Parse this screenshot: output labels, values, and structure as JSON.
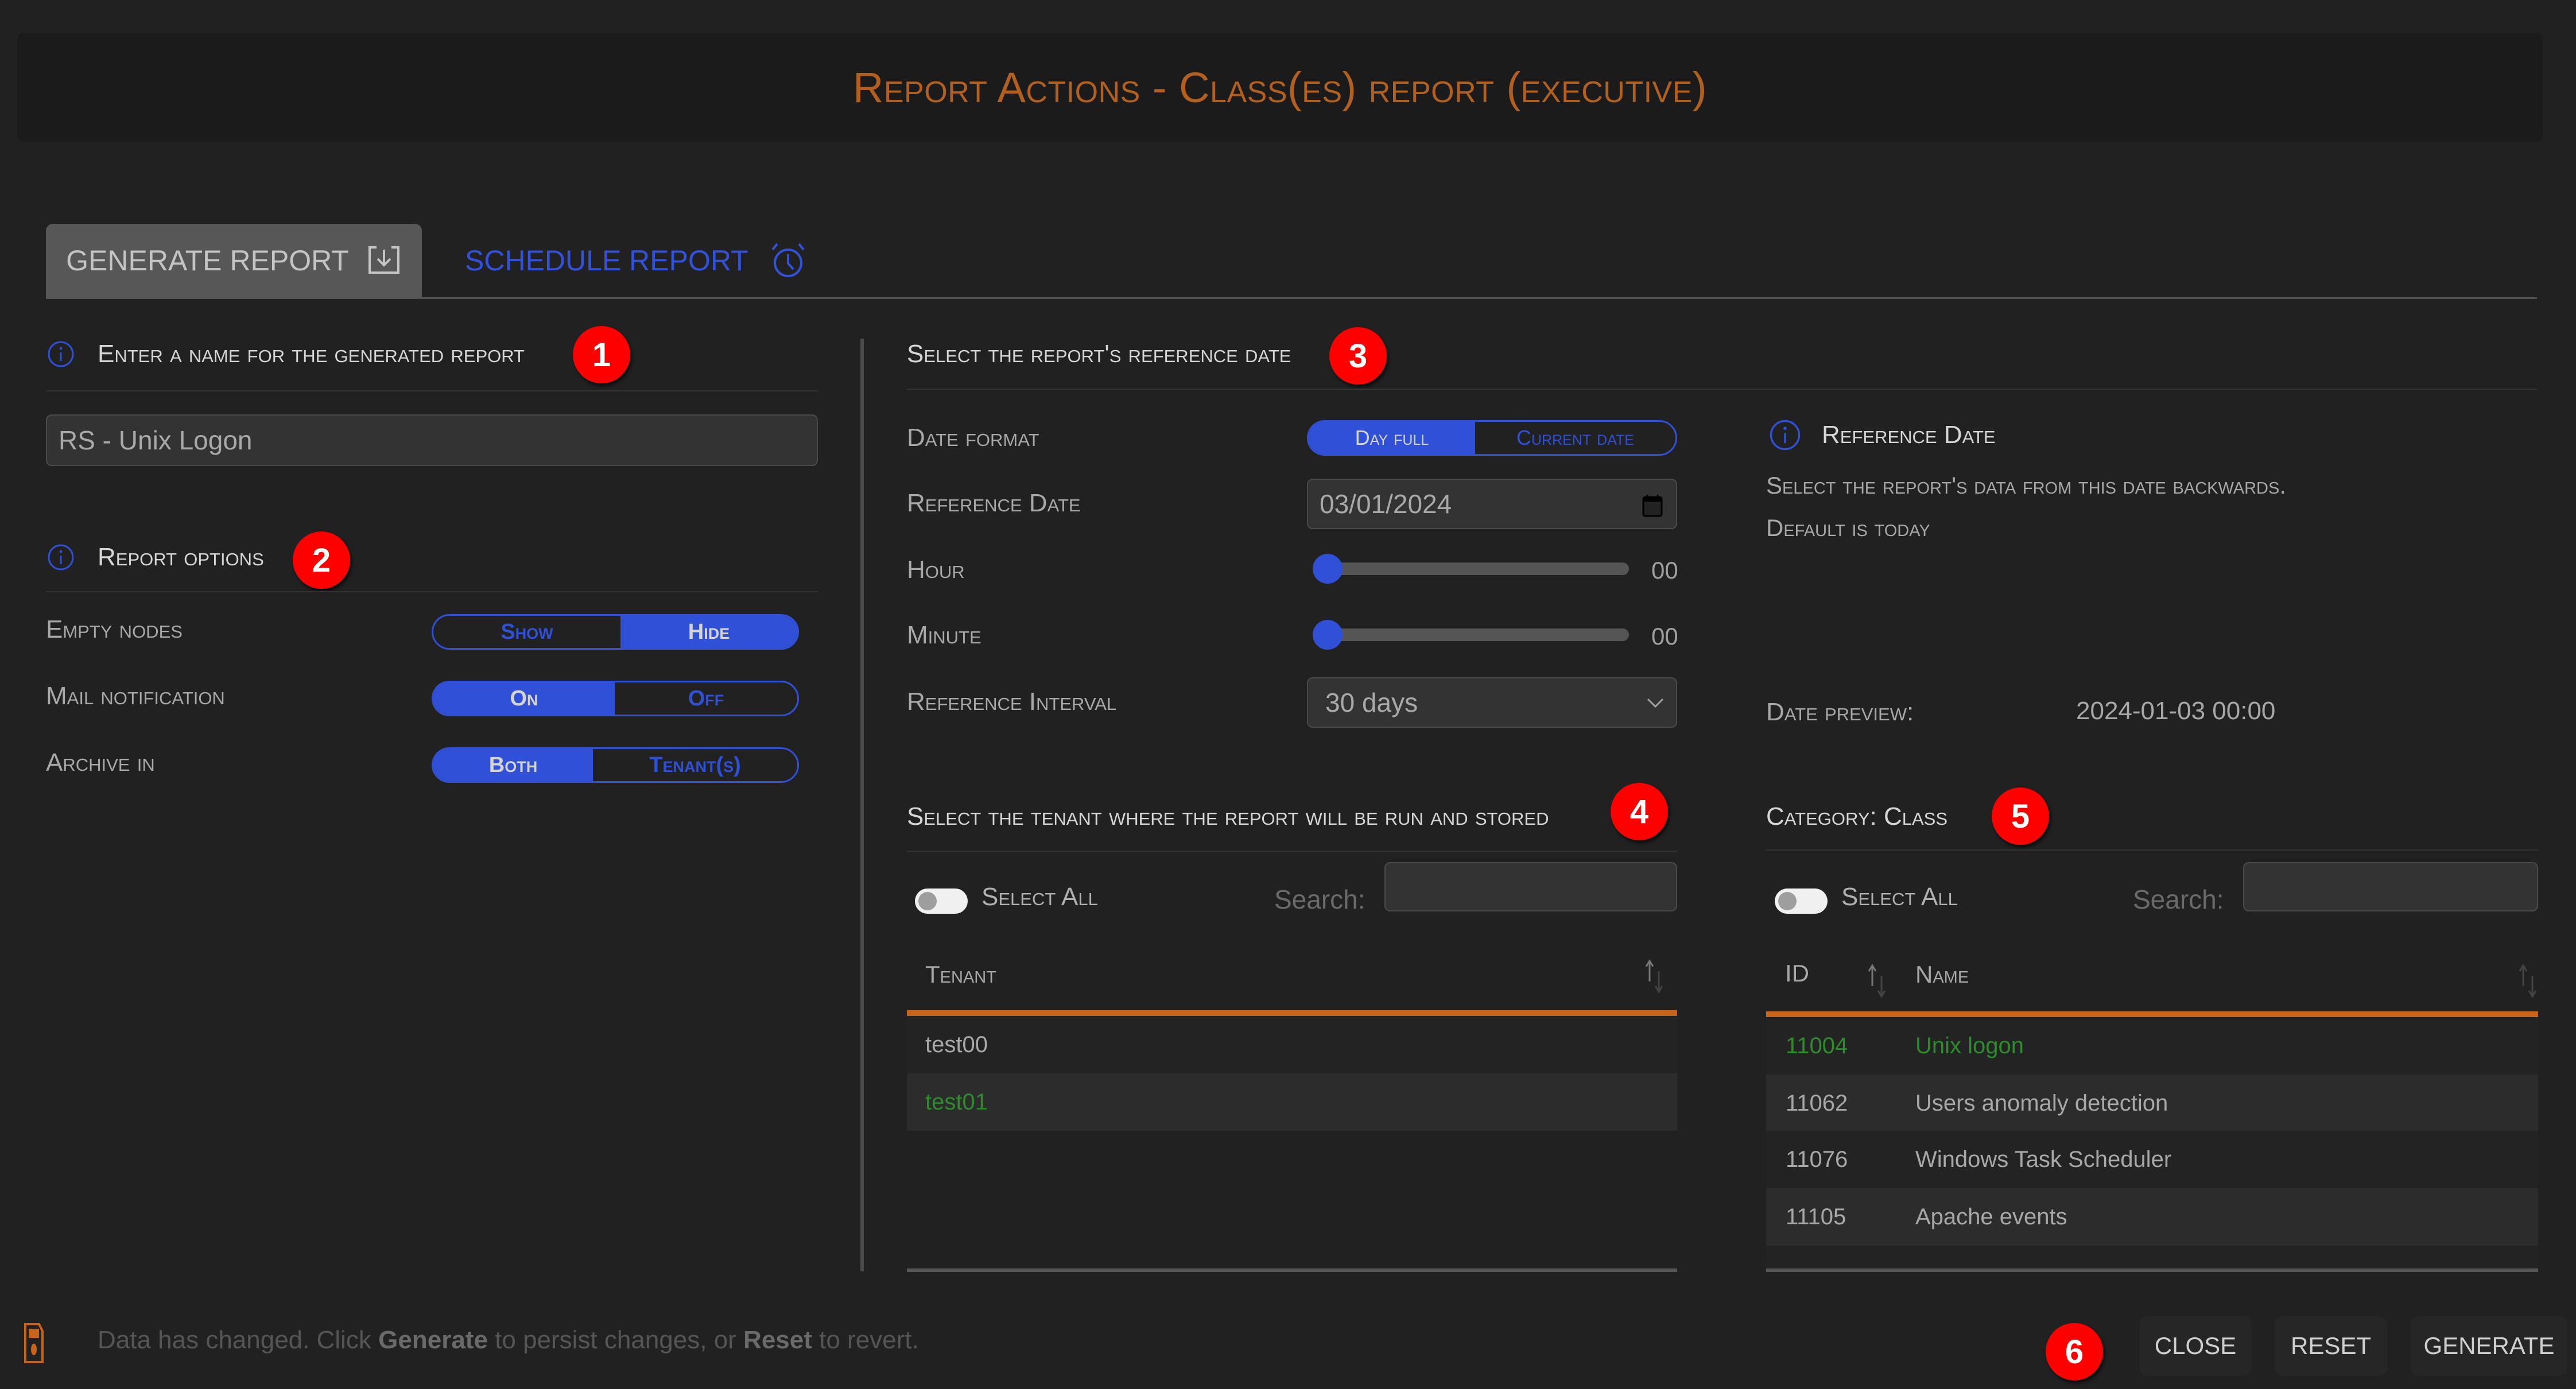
{
  "header": {
    "title": "Report Actions - Class(es) report (executive)"
  },
  "tabs": [
    {
      "label": "GENERATE REPORT",
      "icon": "download-box-icon",
      "active": true
    },
    {
      "label": "SCHEDULE REPORT",
      "icon": "alarm-clock-icon",
      "active": false
    }
  ],
  "steps": [
    "1",
    "2",
    "3",
    "4",
    "5",
    "6"
  ],
  "name_section": {
    "title": "Enter a name for the generated report",
    "value": "RS - Unix Logon"
  },
  "options_section": {
    "title": "Report options",
    "rows": [
      {
        "label": "Empty nodes",
        "options": [
          "Show",
          "Hide"
        ],
        "selected": "Hide"
      },
      {
        "label": "Mail notification",
        "options": [
          "On",
          "Off"
        ],
        "selected": "On"
      },
      {
        "label": "Archive in",
        "options": [
          "Both",
          "Tenant(s)"
        ],
        "selected": "Both"
      }
    ]
  },
  "date_section": {
    "title": "Select the report's reference date",
    "date_format": {
      "label": "Date format",
      "options": [
        "Day full",
        "Current date"
      ],
      "selected": "Day full"
    },
    "reference_date": {
      "label": "Reference Date",
      "value": "03/01/2024"
    },
    "hour": {
      "label": "Hour",
      "value": "00",
      "fraction": 0
    },
    "minute": {
      "label": "Minute",
      "value": "00",
      "fraction": 0
    },
    "interval": {
      "label": "Reference Interval",
      "value": "30 days"
    }
  },
  "reference_info": {
    "title": "Reference Date",
    "line1": "Select the report's data from this date backwards.",
    "line2": "Default is today",
    "preview_label": "Date preview:",
    "preview_value": "2024-01-03 00:00"
  },
  "tenant_section": {
    "title": "Select the tenant where the report will be run and stored",
    "select_all": "Select All",
    "search_label": "Search:",
    "search_value": "",
    "column": "Tenant",
    "rows": [
      {
        "name": "test00",
        "selected": false
      },
      {
        "name": "test01",
        "selected": true
      }
    ]
  },
  "category_section": {
    "title": "Category: Class",
    "select_all": "Select All",
    "search_label": "Search:",
    "search_value": "",
    "columns": [
      "ID",
      "Name"
    ],
    "rows": [
      {
        "id": "11004",
        "name": "Unix logon",
        "selected": true
      },
      {
        "id": "11062",
        "name": "Users anomaly detection",
        "selected": false
      },
      {
        "id": "11076",
        "name": "Windows Task Scheduler",
        "selected": false
      },
      {
        "id": "11105",
        "name": "Apache events",
        "selected": false
      }
    ]
  },
  "footer": {
    "message_parts": [
      "Data has changed. Click ",
      "Generate",
      " to persist changes, or ",
      "Reset",
      " to revert."
    ],
    "buttons": {
      "close": "CLOSE",
      "reset": "RESET",
      "generate": "GENERATE"
    }
  },
  "colors": {
    "accent_blue": "#3050d8",
    "accent_orange": "#c8631a",
    "title_orange": "#b3601f",
    "selected_green": "#2e8b2e",
    "badge_red": "#ff0000"
  }
}
